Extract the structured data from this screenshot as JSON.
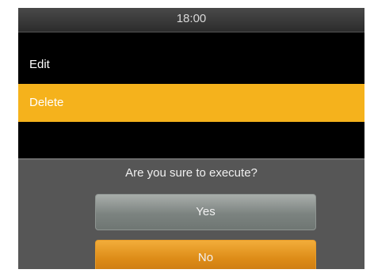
{
  "status_bar": {
    "time": "18:00"
  },
  "menu": {
    "items": [
      {
        "label": "Edit",
        "selected": false
      },
      {
        "label": "Delete",
        "selected": true
      }
    ]
  },
  "dialog": {
    "message": "Are you sure to execute?",
    "yes_label": "Yes",
    "no_label": "No"
  },
  "colors": {
    "highlight": "#f5b21c",
    "yes_button": "#7c8380",
    "no_button": "#dc8a16",
    "dialog_bg": "#565656"
  }
}
